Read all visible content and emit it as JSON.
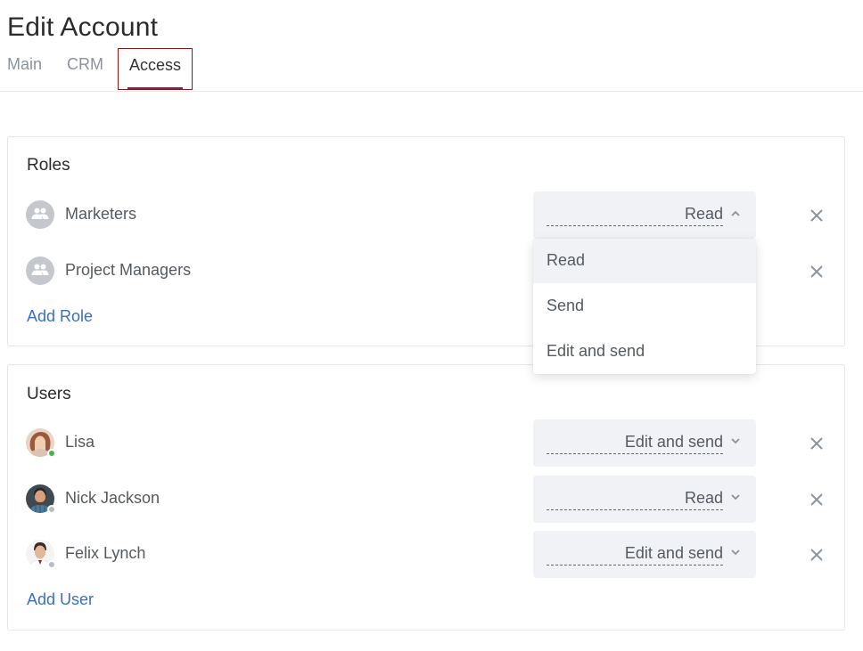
{
  "header": {
    "title": "Edit Account"
  },
  "tabs": [
    {
      "label": "Main"
    },
    {
      "label": "CRM"
    },
    {
      "label": "Access"
    }
  ],
  "roles": {
    "title": "Roles",
    "items": [
      {
        "name": "Marketers",
        "access": "Read"
      },
      {
        "name": "Project Managers"
      }
    ],
    "add_label": "Add Role"
  },
  "users": {
    "title": "Users",
    "items": [
      {
        "name": "Lisa",
        "access": "Edit and send",
        "status": "online"
      },
      {
        "name": "Nick Jackson",
        "access": "Read",
        "status": "offline"
      },
      {
        "name": "Felix Lynch",
        "access": "Edit and send",
        "status": "offline"
      }
    ],
    "add_label": "Add User"
  },
  "dropdown": {
    "options": [
      "Read",
      "Send",
      "Edit and send"
    ],
    "highlighted": "Read"
  },
  "colors": {
    "accent_link": "#3a6fc4",
    "online": "#4caf50",
    "offline": "#b9bcc2",
    "active_tab_outline": "#8b1a1a"
  },
  "icons": {
    "group": "group-icon",
    "chevron_up": "chevron-up-icon",
    "chevron_down": "chevron-down-icon",
    "remove": "close-icon"
  }
}
